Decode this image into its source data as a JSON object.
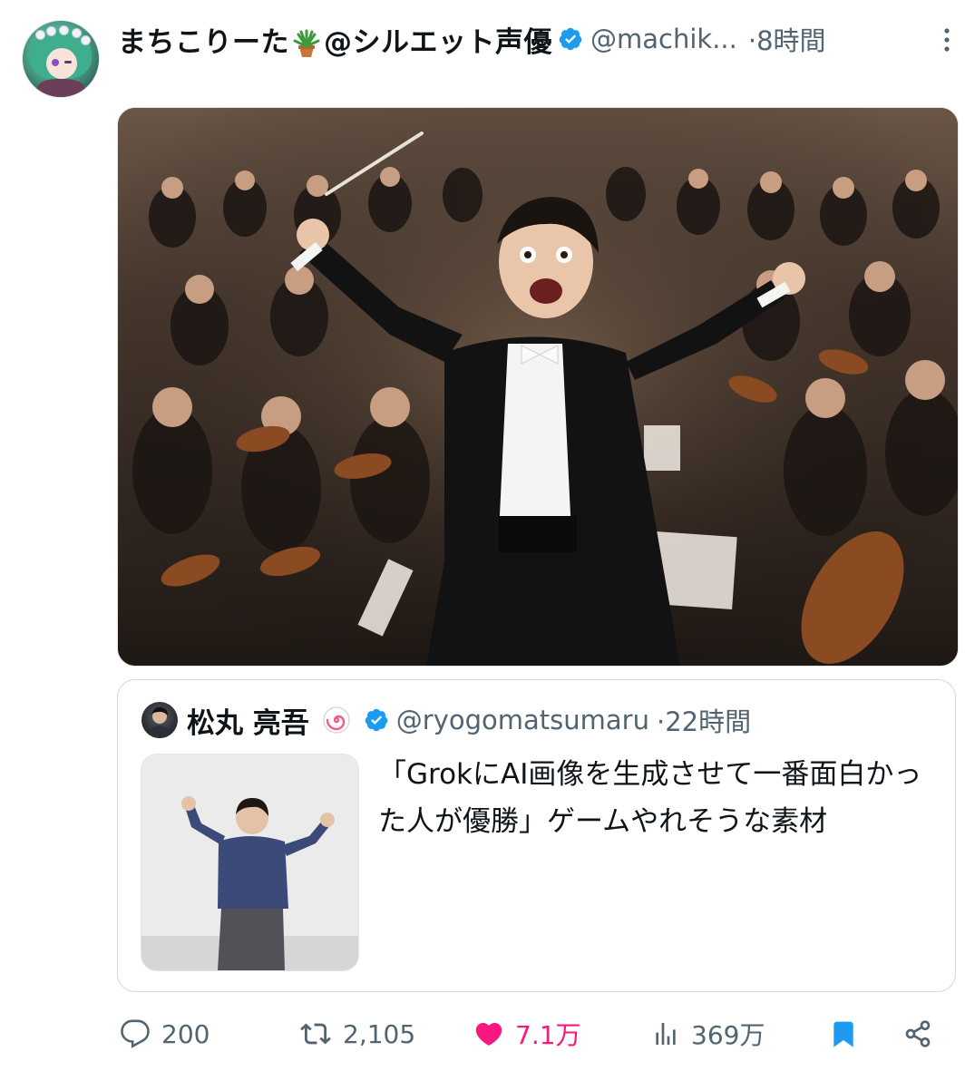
{
  "tweet": {
    "display_name_prefix": "まちこりーた",
    "display_name_suffix": "@シルエット声優",
    "handle": "@machik...",
    "time": "·8時間",
    "media_alt": "",
    "quote": {
      "name": "松丸 亮吾",
      "handle": "@ryogomatsumaru",
      "time": "·22時間",
      "text": "「GrokにAI画像を生成させて一番面白かった人が優勝」ゲームやれそうな素材"
    }
  },
  "actions": {
    "replies": "200",
    "retweets": "2,105",
    "likes": "7.1万",
    "views": "369万"
  },
  "colors": {
    "verified": "#1d9bf0",
    "like": "#f91880",
    "secondary_text": "#536471",
    "bookmark": "#1d9bf0"
  },
  "icons": {
    "reply": "speech-bubble-icon",
    "retweet": "retweet-icon",
    "like": "heart-icon",
    "views": "bar-chart-icon",
    "bookmark": "bookmark-icon",
    "share": "share-icon",
    "more": "vertical-ellipsis-icon"
  }
}
